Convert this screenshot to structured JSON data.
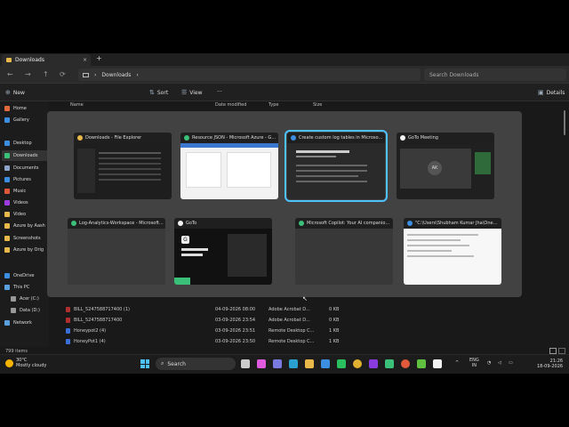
{
  "tab": {
    "title": "Downloads",
    "close": "×",
    "new": "+"
  },
  "address": {
    "crumb_sep": "›",
    "location": "Downloads",
    "search_placeholder": "Search Downloads"
  },
  "nav": {
    "back": "←",
    "forward": "→",
    "up": "↑",
    "refresh": "⟳"
  },
  "commands": {
    "new": "New",
    "sort": "Sort",
    "view": "View",
    "more": "···",
    "details": "Details"
  },
  "sidebar": {
    "items": [
      {
        "label": "Home",
        "color": "#e06a3b"
      },
      {
        "label": "Gallery",
        "color": "#3b8ee0"
      },
      {
        "label": "Desktop",
        "color": "#3b8ee0"
      },
      {
        "label": "Downloads",
        "color": "#3bc07a"
      },
      {
        "label": "Documents",
        "color": "#8ea3c7"
      },
      {
        "label": "Pictures",
        "color": "#3b8ee0"
      },
      {
        "label": "Music",
        "color": "#e0563b"
      },
      {
        "label": "Videos",
        "color": "#9b3be0"
      },
      {
        "label": "Video",
        "color": "#e8b84a"
      },
      {
        "label": "Azure by Aash",
        "color": "#e8b84a"
      },
      {
        "label": "Screenshots",
        "color": "#e8b84a"
      },
      {
        "label": "Azure by Orig",
        "color": "#e8b84a"
      },
      {
        "label": "OneDrive",
        "color": "#3b8ee0"
      },
      {
        "label": "This PC",
        "color": "#5aa0e0"
      },
      {
        "label": "Acer (C:)",
        "color": "#999999"
      },
      {
        "label": "Data (D:)",
        "color": "#999999"
      },
      {
        "label": "Network",
        "color": "#5aa0e0"
      }
    ]
  },
  "columns": {
    "name": "Name",
    "date": "Date modified",
    "type": "Type",
    "size": "Size"
  },
  "files": [
    {
      "name": "BILL_5247588717400 (1)",
      "date": "04-09-2026 08:00",
      "type": "Adobe Acrobat D...",
      "size": "0 KB",
      "kind": "pdf"
    },
    {
      "name": "BILL_5247588717400",
      "date": "03-09-2026 23:54",
      "type": "Adobe Acrobat D...",
      "size": "0 KB",
      "kind": "pdf"
    },
    {
      "name": "Honeypot2 (4)",
      "date": "03-09-2026 23:51",
      "type": "Remote Desktop C...",
      "size": "1 KB",
      "kind": "rdp"
    },
    {
      "name": "HoneyPot1 (4)",
      "date": "03-09-2026 23:50",
      "type": "Remote Desktop C...",
      "size": "1 KB",
      "kind": "rdp"
    }
  ],
  "status": {
    "items": "799 items"
  },
  "windows": [
    {
      "title": "Downloads - File Explorer",
      "icon_color": "#e8b84a",
      "body_color": "#1e1e1e"
    },
    {
      "title": "Resource JSON - Microsoft Azure - Go...",
      "icon_color": "#3bc07a",
      "body_color": "#f2f2f2"
    },
    {
      "title": "Create custom log tables in Microsoft...",
      "icon_color": "#3b8ee0",
      "body_color": "#2a2a2a"
    },
    {
      "title": "GoTo Meeting",
      "icon_color": "#f2f2f2",
      "body_color": "#202020"
    },
    {
      "title": "Log-Analytics-Workspace - Microsoft...",
      "icon_color": "#3bc07a",
      "body_color": "#3a3a3a"
    },
    {
      "title": "GoTo",
      "icon_color": "#f2f2f2",
      "body_color": "#111111"
    },
    {
      "title": "Microsoft Copilot: Your AI companion...",
      "icon_color": "#3bc07a",
      "body_color": "#383838"
    },
    {
      "title": "\"C:\\Users\\Shubham Kumar Jha\\OneDri...",
      "icon_color": "#3b8ee0",
      "body_color": "#f7f7f7"
    }
  ],
  "meeting_avatar": "AK",
  "goto_logo": "G",
  "taskbar": {
    "temp": "30°C",
    "weather": "Mostly cloudy",
    "search": "Search",
    "lang_top": "ENG",
    "lang_bottom": "IN",
    "time": "21:26",
    "date": "18-09-2026",
    "apps": [
      {
        "name": "task-view",
        "color": "#cccccc"
      },
      {
        "name": "copilot",
        "color": "#e05ae0"
      },
      {
        "name": "chat",
        "color": "#7a7ae0"
      },
      {
        "name": "edge",
        "color": "#2aa0d0"
      },
      {
        "name": "explorer",
        "color": "#e8b84a"
      },
      {
        "name": "store",
        "color": "#3b8ee0"
      },
      {
        "name": "outlook",
        "color": "#2a7ad0"
      },
      {
        "name": "whatsapp",
        "color": "#2ac060"
      },
      {
        "name": "chrome",
        "color": "#e0b030"
      },
      {
        "name": "visual-studio",
        "color": "#8a3be0"
      },
      {
        "name": "app-green",
        "color": "#3bc07a"
      },
      {
        "name": "app-blue",
        "color": "#3b8ee0"
      },
      {
        "name": "chrome-2",
        "color": "#e05a3b"
      },
      {
        "name": "app-green-2",
        "color": "#60c040"
      },
      {
        "name": "goto",
        "color": "#f2f2f2"
      }
    ]
  }
}
